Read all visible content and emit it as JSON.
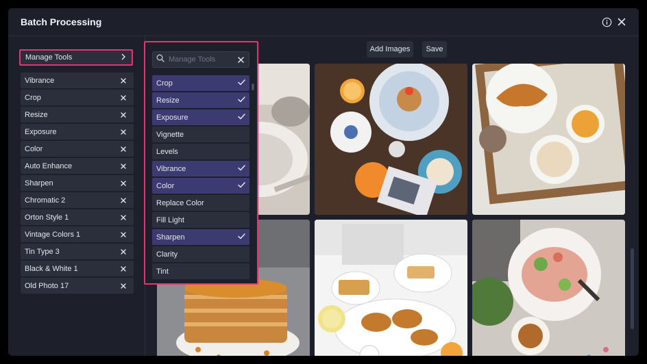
{
  "window": {
    "title": "Batch Processing",
    "info_icon": "info-icon",
    "close_icon": "close-icon"
  },
  "sidebar": {
    "manage_label": "Manage Tools",
    "tools": [
      {
        "label": "Vibrance"
      },
      {
        "label": "Crop"
      },
      {
        "label": "Resize"
      },
      {
        "label": "Exposure"
      },
      {
        "label": "Color"
      },
      {
        "label": "Auto Enhance"
      },
      {
        "label": "Sharpen"
      },
      {
        "label": "Chromatic 2"
      },
      {
        "label": "Orton Style 1"
      },
      {
        "label": "Vintage Colors 1"
      },
      {
        "label": "Tin Type 3"
      },
      {
        "label": "Black & White 1"
      },
      {
        "label": "Old Photo 17"
      }
    ]
  },
  "toolbar": {
    "add_label": "Add Images",
    "save_label": "Save"
  },
  "manage_panel": {
    "search_placeholder": "Manage Tools",
    "options": [
      {
        "label": "Crop",
        "selected": true
      },
      {
        "label": "Resize",
        "selected": true
      },
      {
        "label": "Exposure",
        "selected": true
      },
      {
        "label": "Vignette",
        "selected": false
      },
      {
        "label": "Levels",
        "selected": false
      },
      {
        "label": "Vibrance",
        "selected": true
      },
      {
        "label": "Color",
        "selected": true
      },
      {
        "label": "Replace Color",
        "selected": false
      },
      {
        "label": "Fill Light",
        "selected": false
      },
      {
        "label": "Sharpen",
        "selected": true
      },
      {
        "label": "Clarity",
        "selected": false
      },
      {
        "label": "Tint",
        "selected": false
      }
    ]
  },
  "colors": {
    "accent": "#e8336f",
    "selected": "#3b3b72",
    "panel": "#1d1f2b",
    "item": "#2b2e3b"
  }
}
